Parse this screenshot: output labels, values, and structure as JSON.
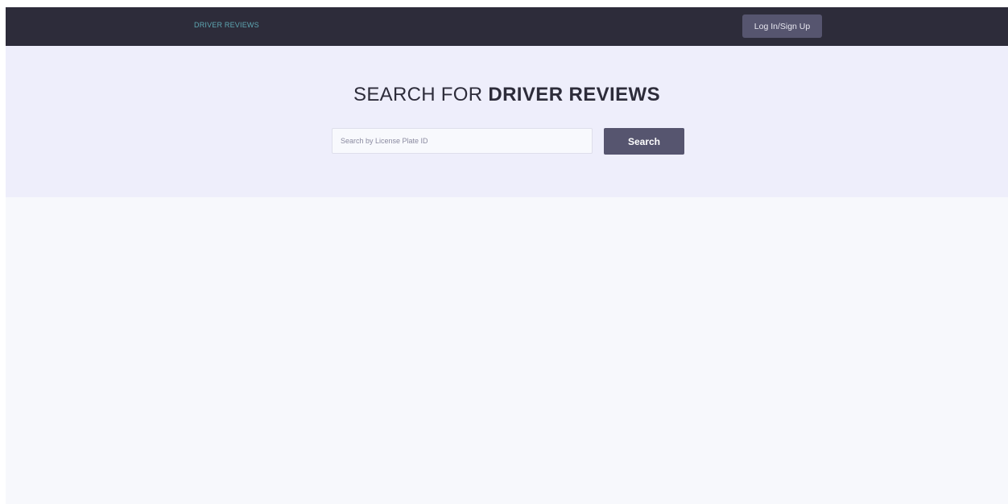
{
  "navbar": {
    "brand": "DRIVER REVIEWS",
    "login_label": "Log In/Sign Up"
  },
  "hero": {
    "title_light": "SEARCH FOR ",
    "title_bold": "DRIVER REVIEWS",
    "search": {
      "placeholder": "Search by License Plate ID",
      "value": "",
      "button_label": "Search"
    }
  },
  "colors": {
    "navbar_bg": "#2d2c3a",
    "brand_text": "#5ea7b3",
    "button_bg": "#56556f",
    "hero_bg": "#eeeefb",
    "page_bg": "#f7f8fc"
  }
}
